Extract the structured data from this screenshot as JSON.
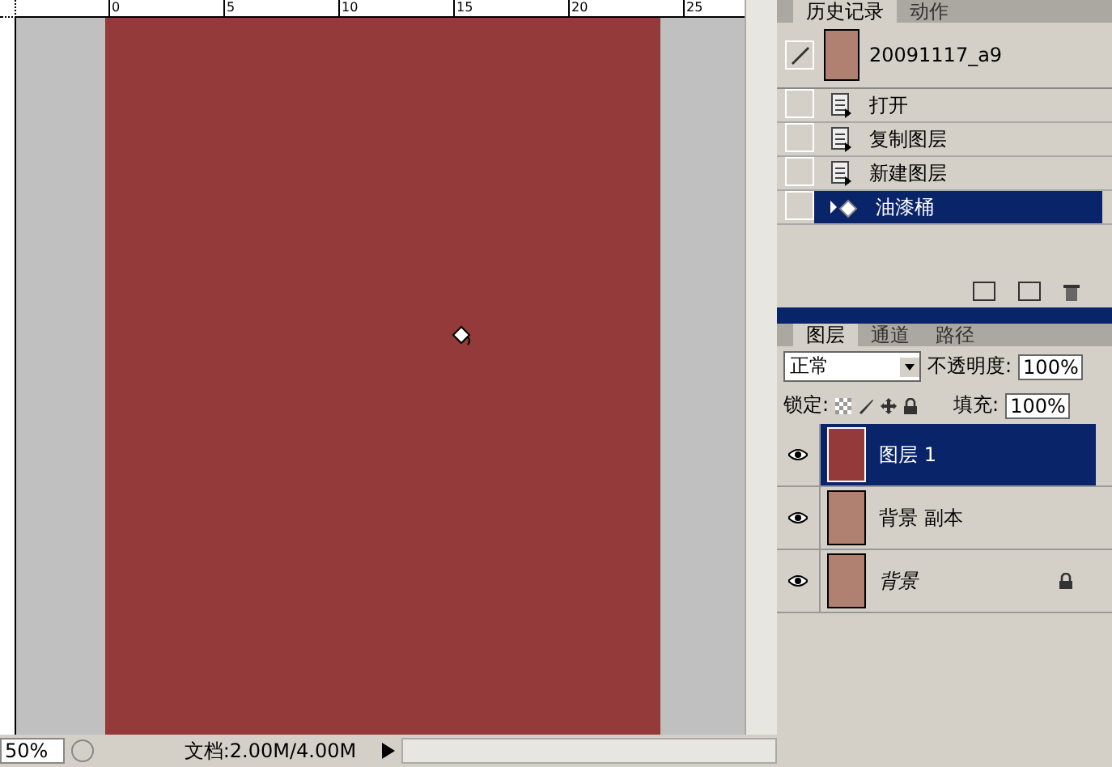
{
  "ruler": {
    "ticks": [
      "0",
      "5",
      "10",
      "15",
      "20",
      "25"
    ]
  },
  "status_bar": {
    "zoom": "50%",
    "doc_info": "文档:2.00M/4.00M"
  },
  "history_panel": {
    "tabs": [
      {
        "label": "历史记录",
        "selected": true
      },
      {
        "label": "动作",
        "selected": false
      }
    ],
    "snapshot": {
      "name": "20091117_a9",
      "brush_source": true
    },
    "items": [
      {
        "label": "打开",
        "kind": "step",
        "selected": false,
        "brush_source": false
      },
      {
        "label": "复制图层",
        "kind": "step",
        "selected": false,
        "brush_source": false
      },
      {
        "label": "新建图层",
        "kind": "step",
        "selected": false,
        "brush_source": false
      },
      {
        "label": "油漆桶",
        "kind": "bucket",
        "selected": true,
        "brush_source": false
      }
    ]
  },
  "layers_panel": {
    "tabs": [
      {
        "label": "图层",
        "selected": true
      },
      {
        "label": "通道",
        "selected": false
      },
      {
        "label": "路径",
        "selected": false
      }
    ],
    "blend_mode": "正常",
    "opacity_label": "不透明度:",
    "opacity": "100%",
    "lock_label": "锁定:",
    "fill_label": "填充:",
    "fill": "100%",
    "layers": [
      {
        "name": "图层 1",
        "kind": "fill",
        "selected": true,
        "visible": true,
        "locked": false,
        "italic": false
      },
      {
        "name": "背景 副本",
        "kind": "photo",
        "selected": false,
        "visible": true,
        "locked": false,
        "italic": false
      },
      {
        "name": "背景",
        "kind": "photo",
        "selected": false,
        "visible": true,
        "locked": true,
        "italic": true
      }
    ]
  }
}
